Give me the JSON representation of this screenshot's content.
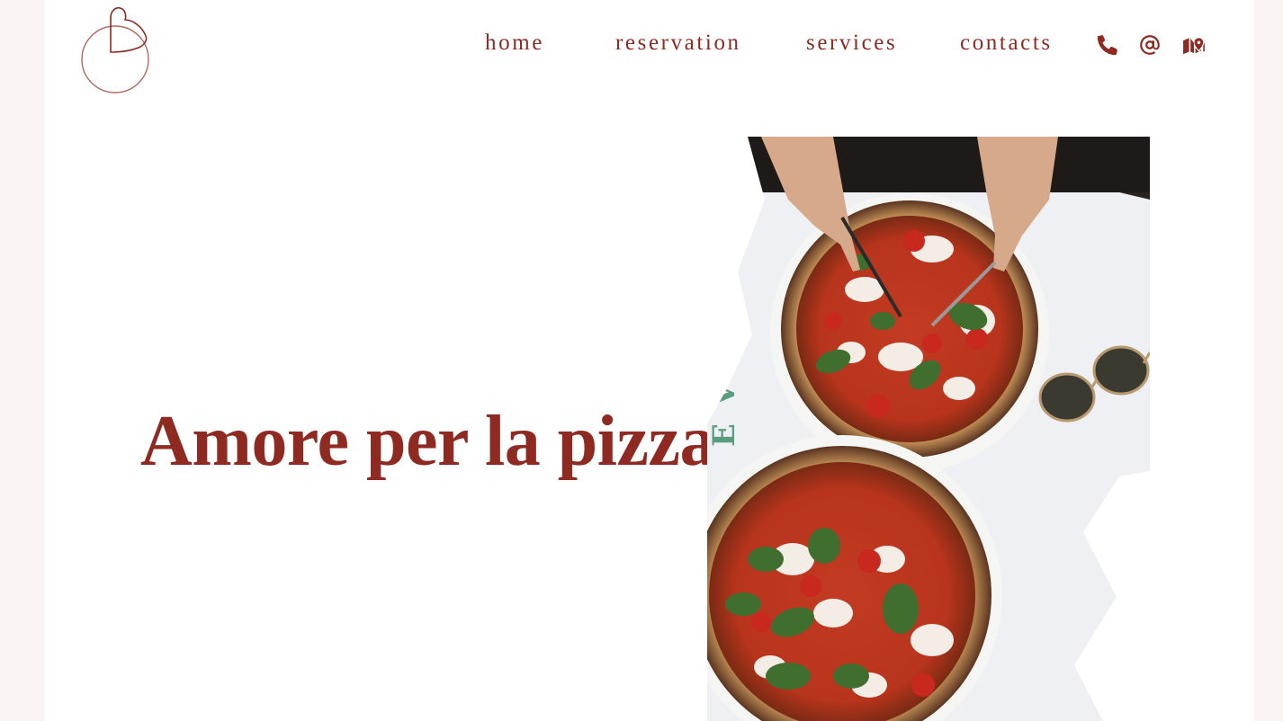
{
  "brand": {
    "logo_icon": "heart-circle-logo-icon",
    "accent_color": "#8e2a22"
  },
  "nav": {
    "items": [
      {
        "label": "home"
      },
      {
        "label": "reservation"
      },
      {
        "label": "services"
      },
      {
        "label": "contacts"
      }
    ],
    "icons": [
      "phone-icon",
      "at-sign-icon",
      "map-icon"
    ]
  },
  "hero": {
    "title": "Amore per la pizza",
    "image_icon": "pizza-photo"
  }
}
